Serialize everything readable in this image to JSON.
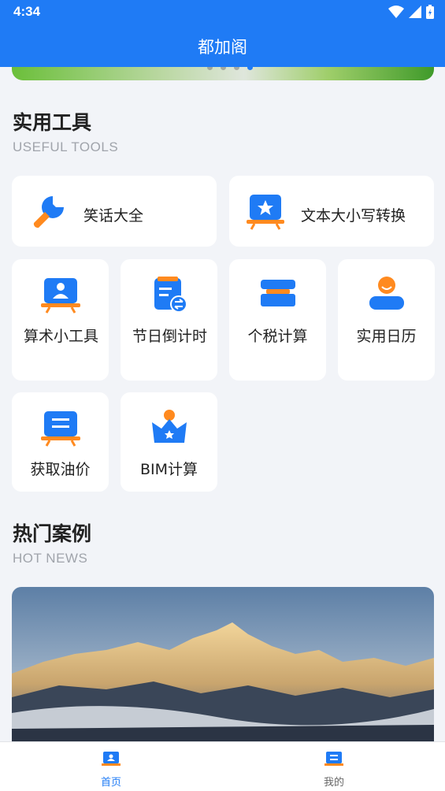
{
  "status_bar": {
    "time": "4:34"
  },
  "app": {
    "title": "都加阁"
  },
  "colors": {
    "primary": "#1f7bf5",
    "accent": "#ff8a1f",
    "background": "#f2f4f8"
  },
  "tools": {
    "title": "实用工具",
    "subtitle": "USEFUL TOOLS",
    "items": [
      {
        "label": "笑话大全",
        "icon": "wrench-icon"
      },
      {
        "label": "文本大小写转换",
        "icon": "star-board-icon"
      },
      {
        "label": "算术小工具",
        "icon": "person-board-icon"
      },
      {
        "label": "节日倒计时",
        "icon": "clipboard-exchange-icon"
      },
      {
        "label": "个税计算",
        "icon": "bed-icon"
      },
      {
        "label": "实用日历",
        "icon": "user-avatar-icon"
      },
      {
        "label": "获取油价",
        "icon": "list-board-icon"
      },
      {
        "label": "BIM计算",
        "icon": "crown-icon"
      }
    ]
  },
  "news": {
    "title": "热门案例",
    "subtitle": "HOT NEWS"
  },
  "bottom_nav": [
    {
      "label": "首页",
      "icon": "home-board-icon",
      "active": true
    },
    {
      "label": "我的",
      "icon": "profile-board-icon",
      "active": false
    }
  ]
}
